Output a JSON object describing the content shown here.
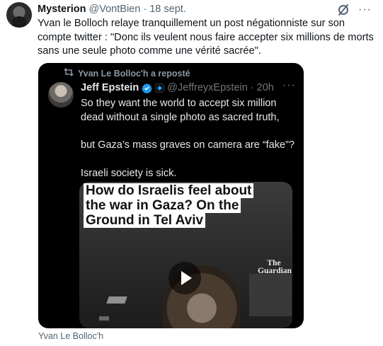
{
  "post": {
    "author_name": "Mysterion",
    "author_handle": "@VontBien",
    "separator": "·",
    "date": "18 sept.",
    "text": "Yvan le Bolloch relaye tranquillement un post négationniste sur son compte twitter : \"Donc ils veulent nous faire accepter six millions de morts sans une seule photo comme une vérité sacrée\".",
    "more_label": "···"
  },
  "quoted": {
    "repost_label": "Yvan Le Bolloc'h a reposté",
    "author_name": "Jeff Epstein",
    "author_handle": "@JeffreyxEpstein",
    "separator": "·",
    "time": "20h",
    "more_label": "···",
    "paragraphs": [
      "So they want the world to accept six million dead without a single photo as sacred truth,",
      "but Gaza’s mass graves on camera are “fake”?",
      "Israeli society is sick."
    ],
    "video": {
      "title": "How do Israelis feel about the war in Gaza? On the Ground in Tel Aviv",
      "logo_line1": "The",
      "logo_line2": "Guardian"
    }
  },
  "caption": "Yvan Le Bolloc'h",
  "colors": {
    "verified": "#1d9bf0",
    "muted": "#536471",
    "card_bg": "#000000"
  },
  "icons": [
    "grok-icon",
    "more-icon",
    "repost-icon",
    "verified-badge-icon",
    "affiliate-badge-icon",
    "play-icon"
  ]
}
